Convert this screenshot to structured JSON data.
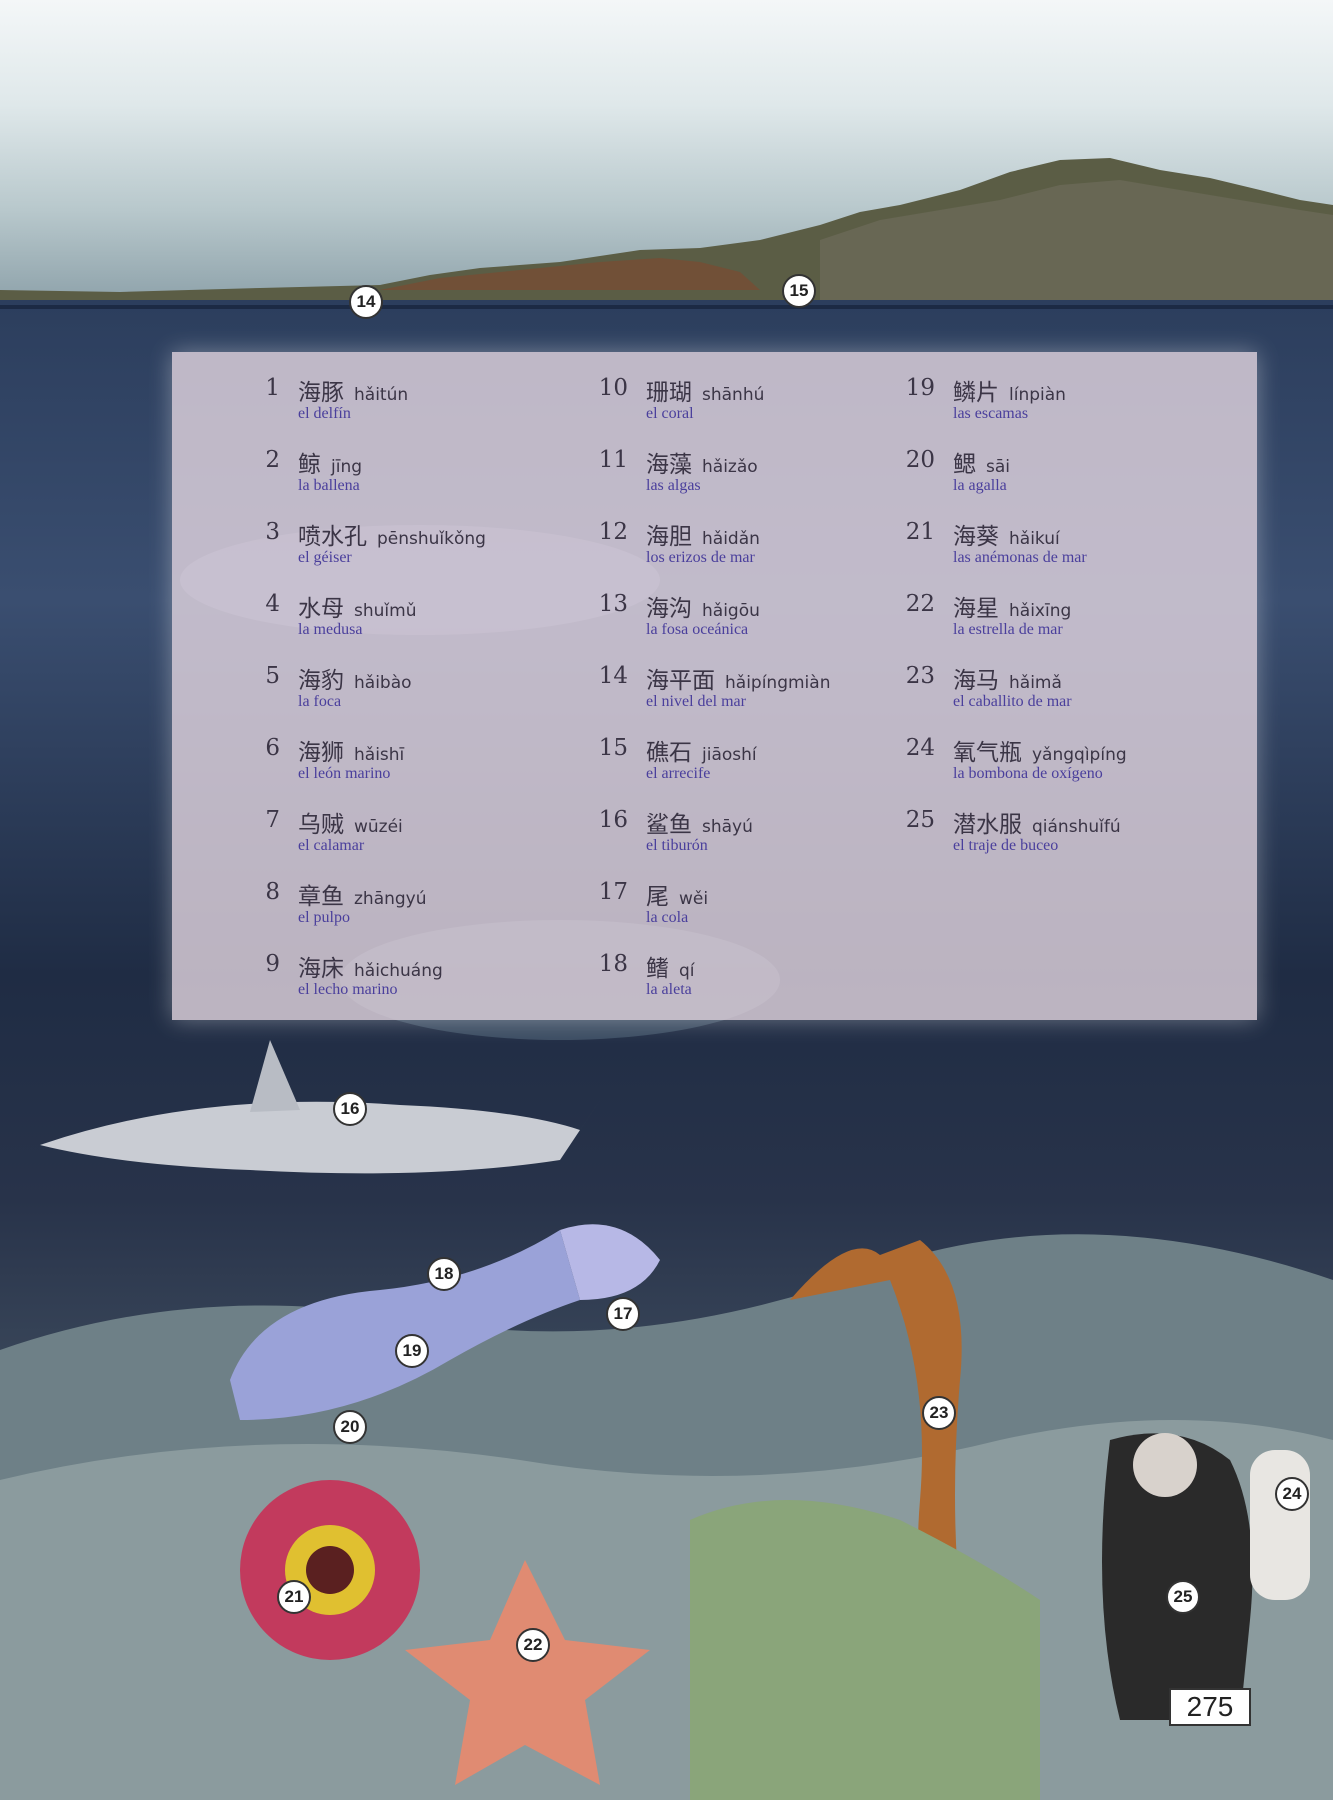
{
  "vocabulary": {
    "column1": [
      {
        "num": "1",
        "hanzi": "海豚",
        "pinyin": "hǎitún",
        "spanish": "el delfín"
      },
      {
        "num": "2",
        "hanzi": "鲸",
        "pinyin": "jīng",
        "spanish": "la ballena"
      },
      {
        "num": "3",
        "hanzi": "喷水孔",
        "pinyin": "pēnshuǐkǒng",
        "spanish": "el géiser"
      },
      {
        "num": "4",
        "hanzi": "水母",
        "pinyin": "shuǐmǔ",
        "spanish": "la medusa"
      },
      {
        "num": "5",
        "hanzi": "海豹",
        "pinyin": "hǎibào",
        "spanish": "la foca"
      },
      {
        "num": "6",
        "hanzi": "海狮",
        "pinyin": "hǎishī",
        "spanish": "el león marino"
      },
      {
        "num": "7",
        "hanzi": "乌贼",
        "pinyin": "wūzéi",
        "spanish": "el calamar"
      },
      {
        "num": "8",
        "hanzi": "章鱼",
        "pinyin": "zhāngyú",
        "spanish": "el pulpo"
      },
      {
        "num": "9",
        "hanzi": "海床",
        "pinyin": "hǎichuáng",
        "spanish": "el lecho marino"
      }
    ],
    "column2": [
      {
        "num": "10",
        "hanzi": "珊瑚",
        "pinyin": "shānhú",
        "spanish": "el coral"
      },
      {
        "num": "11",
        "hanzi": "海藻",
        "pinyin": "hǎizǎo",
        "spanish": "las algas"
      },
      {
        "num": "12",
        "hanzi": "海胆",
        "pinyin": "hǎidǎn",
        "spanish": "los erizos de mar"
      },
      {
        "num": "13",
        "hanzi": "海沟",
        "pinyin": "hǎigōu",
        "spanish": "la fosa oceánica"
      },
      {
        "num": "14",
        "hanzi": "海平面",
        "pinyin": "hǎipíngmiàn",
        "spanish": "el nivel del mar"
      },
      {
        "num": "15",
        "hanzi": "礁石",
        "pinyin": "jiāoshí",
        "spanish": "el arrecife"
      },
      {
        "num": "16",
        "hanzi": "鲨鱼",
        "pinyin": "shāyú",
        "spanish": "el tiburón"
      },
      {
        "num": "17",
        "hanzi": "尾",
        "pinyin": "wěi",
        "spanish": "la cola"
      },
      {
        "num": "18",
        "hanzi": "鳍",
        "pinyin": "qí",
        "spanish": "la aleta"
      }
    ],
    "column3": [
      {
        "num": "19",
        "hanzi": "鳞片",
        "pinyin": "línpiàn",
        "spanish": "las escamas"
      },
      {
        "num": "20",
        "hanzi": "鳃",
        "pinyin": "sāi",
        "spanish": "la agalla"
      },
      {
        "num": "21",
        "hanzi": "海葵",
        "pinyin": "hǎikuí",
        "spanish": "las anémonas de mar"
      },
      {
        "num": "22",
        "hanzi": "海星",
        "pinyin": "hǎixīng",
        "spanish": "la estrella de mar"
      },
      {
        "num": "23",
        "hanzi": "海马",
        "pinyin": "hǎimǎ",
        "spanish": "el caballito de mar"
      },
      {
        "num": "24",
        "hanzi": "氧气瓶",
        "pinyin": "yǎngqìpíng",
        "spanish": "la bombona de oxígeno"
      },
      {
        "num": "25",
        "hanzi": "潜水服",
        "pinyin": "qiánshuǐfú",
        "spanish": "el traje de buceo"
      }
    ]
  },
  "markers": {
    "m14": "14",
    "m15": "15",
    "m16": "16",
    "m17": "17",
    "m18": "18",
    "m19": "19",
    "m20": "20",
    "m21": "21",
    "m22": "22",
    "m23": "23",
    "m24": "24",
    "m25": "25"
  },
  "page_number": "275",
  "colors": {
    "spanish_text": "#4a3f9c",
    "chinese_text": "#3b3546",
    "panel": "#e8dae4",
    "sea_deep": "#1f2c44"
  }
}
